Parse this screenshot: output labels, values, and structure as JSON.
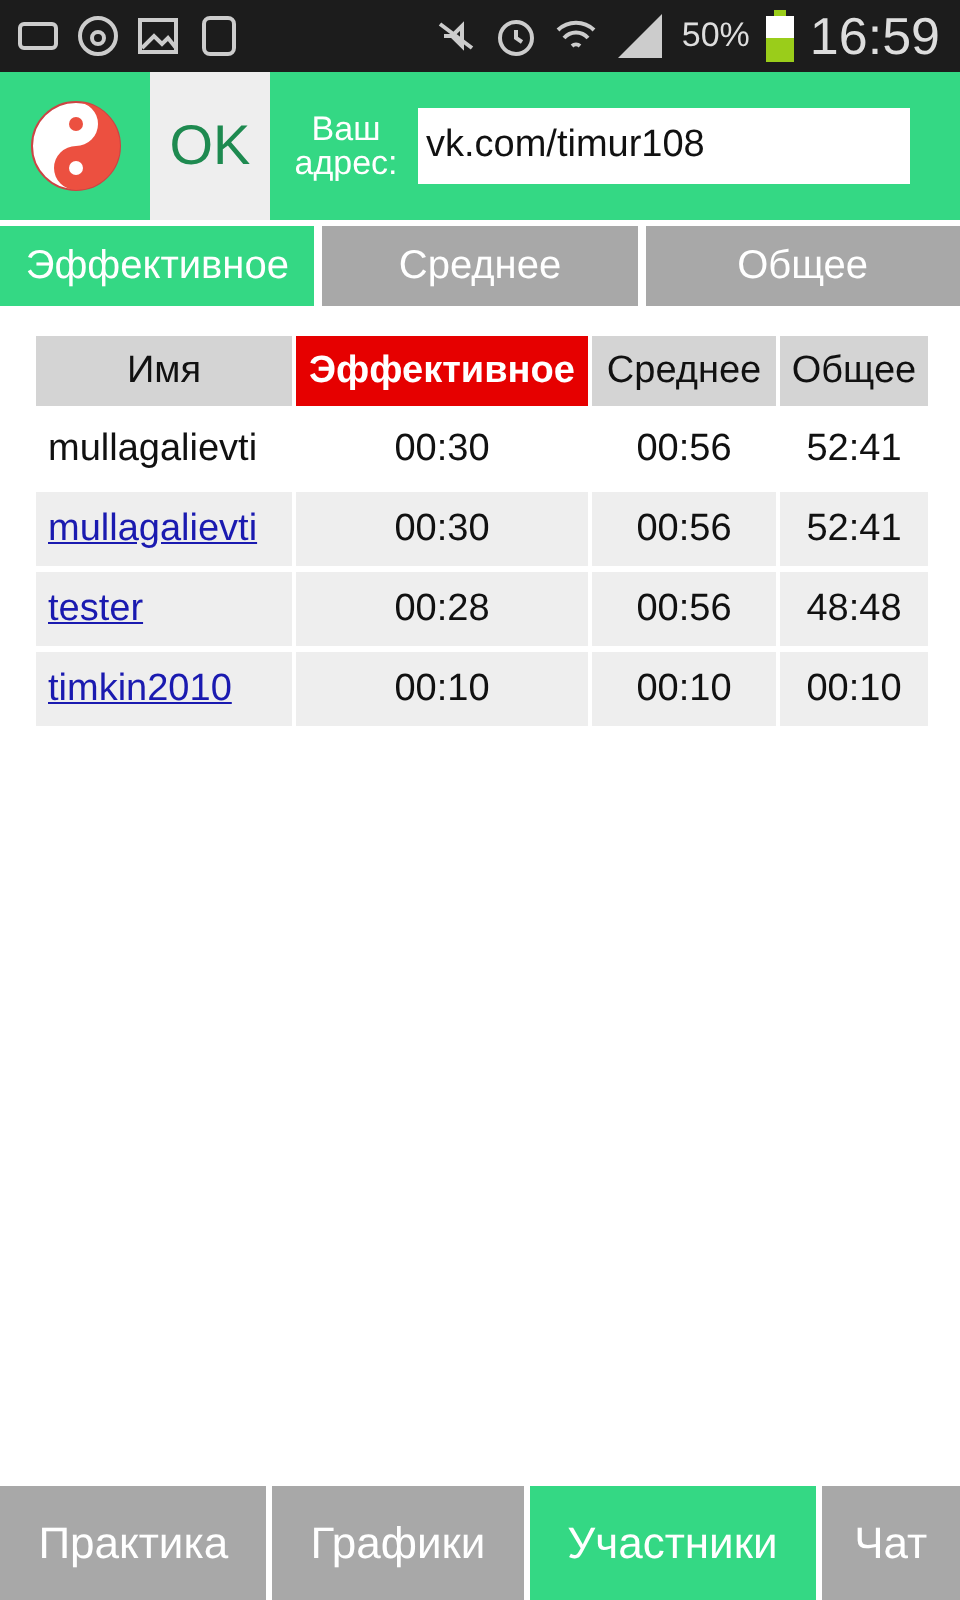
{
  "status_bar": {
    "battery_text": "50%",
    "time": "16:59"
  },
  "header": {
    "button": "OK",
    "address_label": "Ваш адрес:",
    "address_value": "vk.com/timur108"
  },
  "tabs": [
    {
      "label": "Эффективное",
      "selected": true
    },
    {
      "label": "Среднее",
      "selected": false
    },
    {
      "label": "Общее",
      "selected": false
    }
  ],
  "table": {
    "columns": [
      {
        "label": "Имя",
        "selected": false
      },
      {
        "label": "Эффективное",
        "selected": true
      },
      {
        "label": "Среднее",
        "selected": false
      },
      {
        "label": "Общее",
        "selected": false
      }
    ],
    "rows": [
      {
        "kind": "plain",
        "cells": [
          "mullagalievti",
          "00:30",
          "00:56",
          "52:41"
        ]
      },
      {
        "kind": "link",
        "cells": [
          "mullagalievti",
          "00:30",
          "00:56",
          "52:41"
        ]
      },
      {
        "kind": "link",
        "cells": [
          "tester",
          "00:28",
          "00:56",
          "48:48"
        ]
      },
      {
        "kind": "link",
        "cells": [
          "timkin2010",
          "00:10",
          "00:10",
          "00:10"
        ]
      }
    ]
  },
  "bottom_nav": [
    {
      "label": "Практика",
      "selected": false
    },
    {
      "label": "Графики",
      "selected": false
    },
    {
      "label": "Участники",
      "selected": true
    },
    {
      "label": "Чат",
      "selected": false
    }
  ]
}
